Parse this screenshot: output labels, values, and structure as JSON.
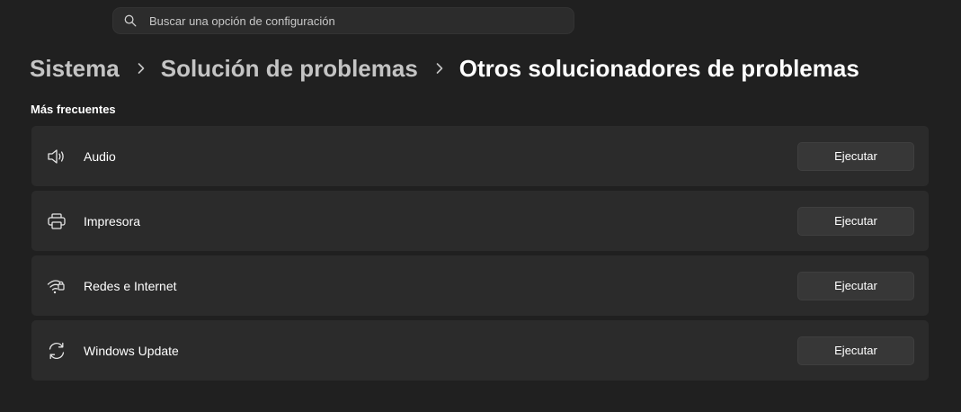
{
  "search": {
    "placeholder": "Buscar una opción de configuración",
    "icon": "search-icon"
  },
  "breadcrumb": {
    "items": [
      "Sistema",
      "Solución de problemas",
      "Otros solucionadores de problemas"
    ],
    "separator_icon": "chevron-right-icon"
  },
  "section": {
    "title": "Más frecuentes"
  },
  "troubleshooters": [
    {
      "label": "Audio",
      "icon": "speaker-icon",
      "button": "Ejecutar"
    },
    {
      "label": "Impresora",
      "icon": "printer-icon",
      "button": "Ejecutar"
    },
    {
      "label": "Redes e Internet",
      "icon": "wifi-lock-icon",
      "button": "Ejecutar"
    },
    {
      "label": "Windows Update",
      "icon": "sync-icon",
      "button": "Ejecutar"
    }
  ],
  "colors": {
    "background": "#202020",
    "card": "#2b2b2b",
    "button": "#373737",
    "muted_text": "#c4c4c4"
  }
}
